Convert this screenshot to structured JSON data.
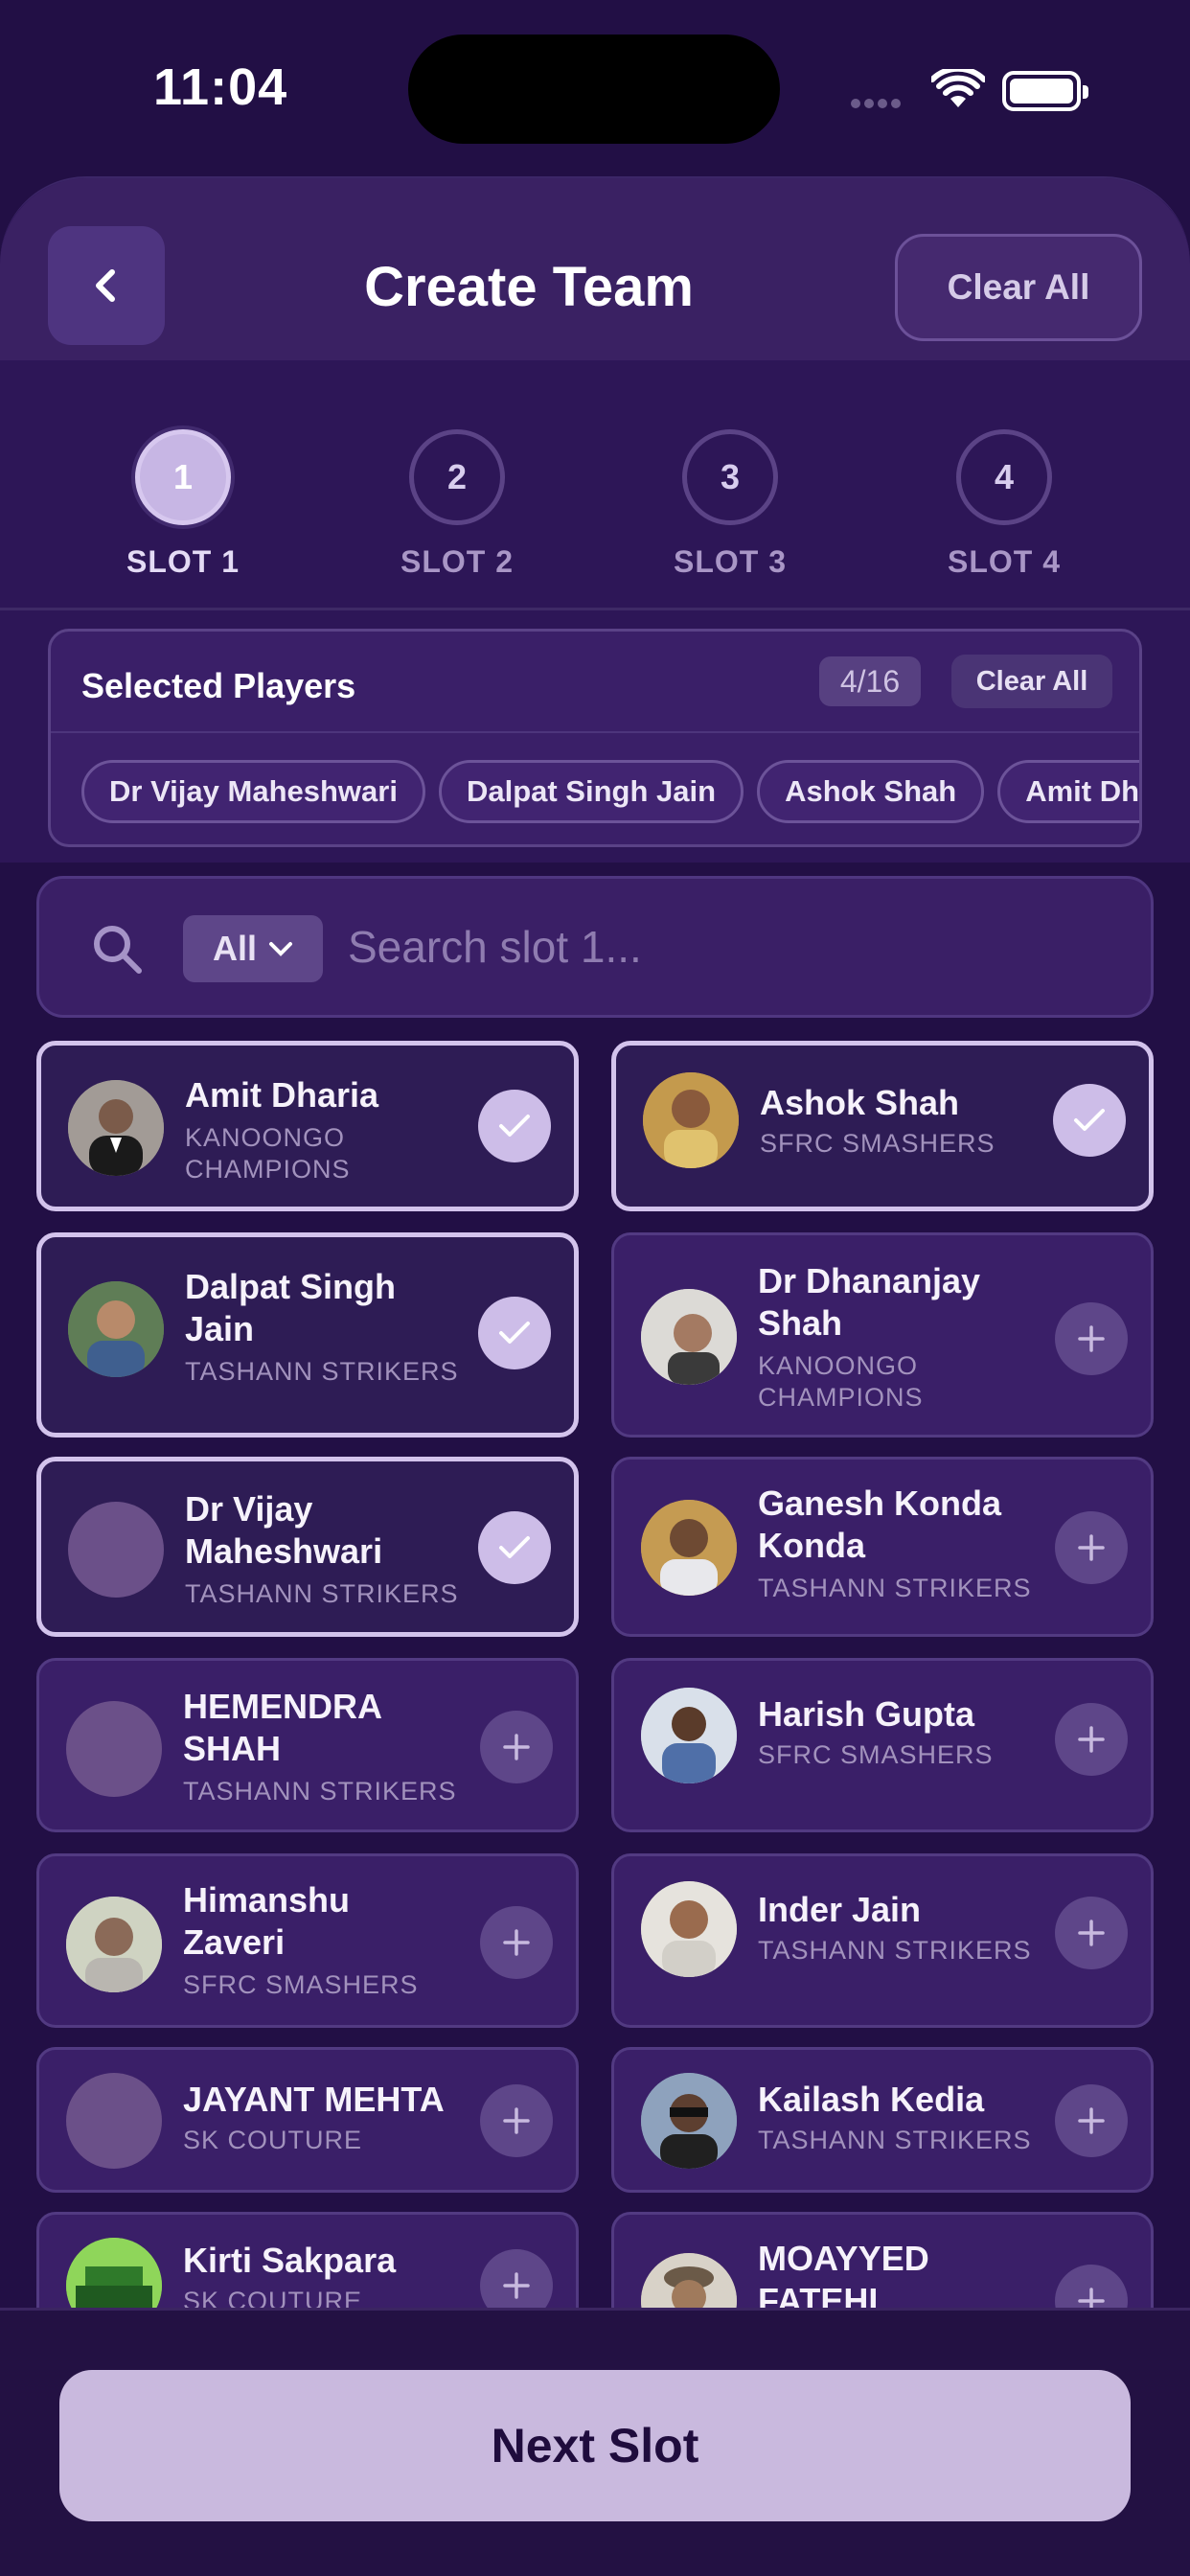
{
  "status": {
    "time": "11:04"
  },
  "header": {
    "title": "Create Team",
    "clear_all": "Clear All"
  },
  "slots": [
    {
      "number": "1",
      "label": "SLOT 1",
      "active": true
    },
    {
      "number": "2",
      "label": "SLOT 2",
      "active": false
    },
    {
      "number": "3",
      "label": "SLOT 3",
      "active": false
    },
    {
      "number": "4",
      "label": "SLOT 4",
      "active": false
    }
  ],
  "selected": {
    "title": "Selected Players",
    "count": "4/16",
    "clear_all": "Clear All",
    "chips": [
      "Dr Vijay Maheshwari",
      "Dalpat Singh Jain",
      "Ashok Shah",
      "Amit Dharia"
    ]
  },
  "search": {
    "filter": "All",
    "placeholder": "Search slot 1..."
  },
  "players": [
    {
      "name": "Amit Dharia",
      "team": "KANOONGO CHAMPIONS",
      "selected": true,
      "photo": true
    },
    {
      "name": "Ashok Shah",
      "team": "SFRC SMASHERS",
      "selected": true,
      "photo": true
    },
    {
      "name": "Dalpat Singh Jain",
      "team": "TASHANN STRIKERS",
      "selected": true,
      "photo": true
    },
    {
      "name": "Dr Dhananjay Shah",
      "team": "KANOONGO CHAMPIONS",
      "selected": false,
      "photo": true
    },
    {
      "name": "Dr Vijay Maheshwari",
      "team": "TASHANN STRIKERS",
      "selected": true,
      "photo": false
    },
    {
      "name": "Ganesh Konda Konda",
      "team": "TASHANN STRIKERS",
      "selected": false,
      "photo": true
    },
    {
      "name": "HEMENDRA SHAH",
      "team": "TASHANN STRIKERS",
      "selected": false,
      "photo": false
    },
    {
      "name": "Harish Gupta",
      "team": "SFRC SMASHERS",
      "selected": false,
      "photo": true
    },
    {
      "name": "Himanshu Zaveri",
      "team": "SFRC SMASHERS",
      "selected": false,
      "photo": true
    },
    {
      "name": "Inder  Jain",
      "team": "TASHANN STRIKERS",
      "selected": false,
      "photo": true
    },
    {
      "name": "JAYANT MEHTA",
      "team": "SK COUTURE",
      "selected": false,
      "photo": false
    },
    {
      "name": "Kailash Kedia",
      "team": "TASHANN STRIKERS",
      "selected": false,
      "photo": true
    },
    {
      "name": "Kirti Sakpara",
      "team": "SK COUTURE",
      "selected": false,
      "photo": true
    },
    {
      "name": "MOAYYED FATEHI",
      "team": "",
      "selected": false,
      "photo": true
    }
  ],
  "footer": {
    "next": "Next Slot"
  },
  "colors": {
    "accent": "#c9b9de",
    "background": "#220f45",
    "card": "#3a1f68"
  }
}
